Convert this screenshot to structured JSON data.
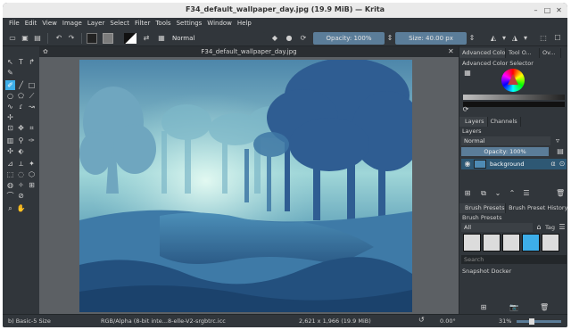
{
  "window": {
    "title": "F34_default_wallpaper_day.jpg (19.9 MiB) — Krita"
  },
  "menu": [
    "File",
    "Edit",
    "View",
    "Image",
    "Layer",
    "Select",
    "Filter",
    "Tools",
    "Settings",
    "Window",
    "Help"
  ],
  "toolbar": {
    "blend_mode": "Normal",
    "opacity": "Opacity: 100%",
    "size": "Size: 40.00 px"
  },
  "document": {
    "tab_title": "F34_default_wallpaper_day.jpg"
  },
  "dock": {
    "top_tabs": [
      "Advanced Color S...",
      "Tool O...",
      "Ov..."
    ],
    "color_selector_title": "Advanced Color Selector",
    "layer_tabs": [
      "Layers",
      "Channels"
    ],
    "layers_label": "Layers",
    "blend_mode": "Normal",
    "opacity": "Opacity: 100%",
    "layer_name": "background",
    "brush_tabs": [
      "Brush Presets",
      "Brush Preset History"
    ],
    "brush_presets_label": "Brush Presets",
    "filter_all": "All",
    "tag_label": "Tag",
    "search_placeholder": "Search",
    "snapshot_label": "Snapshot Docker"
  },
  "status": {
    "brush": "b) Basic-5 Size",
    "color_info": "RGB/Alpha (8-bit inte...8-elle-V2-srgbtrc.icc",
    "dimensions": "2,621 x 1,966 (19.9 MiB)",
    "angle": "0.00°",
    "zoom": "31%"
  },
  "colors": {
    "accent": "#3daee9",
    "background": "#31363b"
  }
}
